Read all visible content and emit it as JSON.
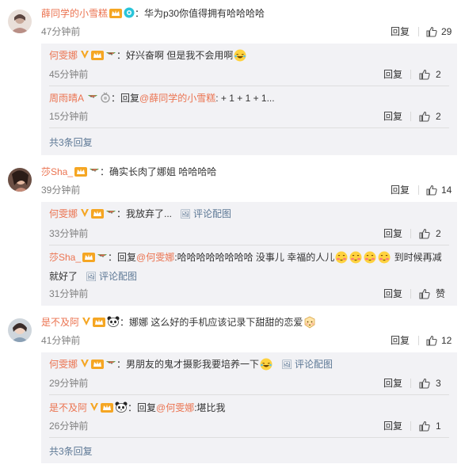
{
  "actions": {
    "reply": "回复",
    "pic": "评论配图"
  },
  "comments": [
    {
      "user": "薛同学的小雪糕",
      "text": "：华为p30你值得拥有哈哈哈哈",
      "time": "47分钟前",
      "likes": "29",
      "replies": [
        {
          "user": "何雯娜",
          "text": "：好兴奋啊 但是我不会用啊",
          "time": "45分钟前",
          "likes": "2"
        },
        {
          "user": "周雨晴A",
          "text_prefix": "：回复",
          "mention": "@薛同学的小雪糕",
          "text": ": + 1 + 1 + 1...",
          "time": "15分钟前",
          "likes": "2"
        }
      ],
      "more": "共3条回复"
    },
    {
      "user": "莎Sha_",
      "text": "：确实长肉了娜姐 哈哈哈哈",
      "time": "39分钟前",
      "likes": "14",
      "replies": [
        {
          "user": "何雯娜",
          "text": "：我放弃了...",
          "time": "33分钟前",
          "likes": "2"
        },
        {
          "user": "莎Sha_",
          "text_prefix": "：回复",
          "mention": "@何雯娜",
          "text": ":哈哈哈哈哈哈哈哈 没事儿 幸福的人儿",
          "text_tail": " 到时候再减",
          "text_line2": "就好了",
          "time": "31分钟前",
          "likes": "赞"
        }
      ]
    },
    {
      "user": "是不及阿",
      "text": "：娜娜 这么好的手机应该记录下甜甜的恋爱",
      "time": "41分钟前",
      "likes": "12",
      "replies": [
        {
          "user": "何雯娜",
          "text": "：男朋友的鬼才摄影我要培养一下",
          "time": "29分钟前",
          "likes": "3"
        },
        {
          "user": "是不及阿",
          "text_prefix": "：回复",
          "mention": "@何雯娜",
          "text": ":堪比我",
          "time": "26分钟前",
          "likes": "1"
        }
      ],
      "more": "共3条回复"
    }
  ]
}
